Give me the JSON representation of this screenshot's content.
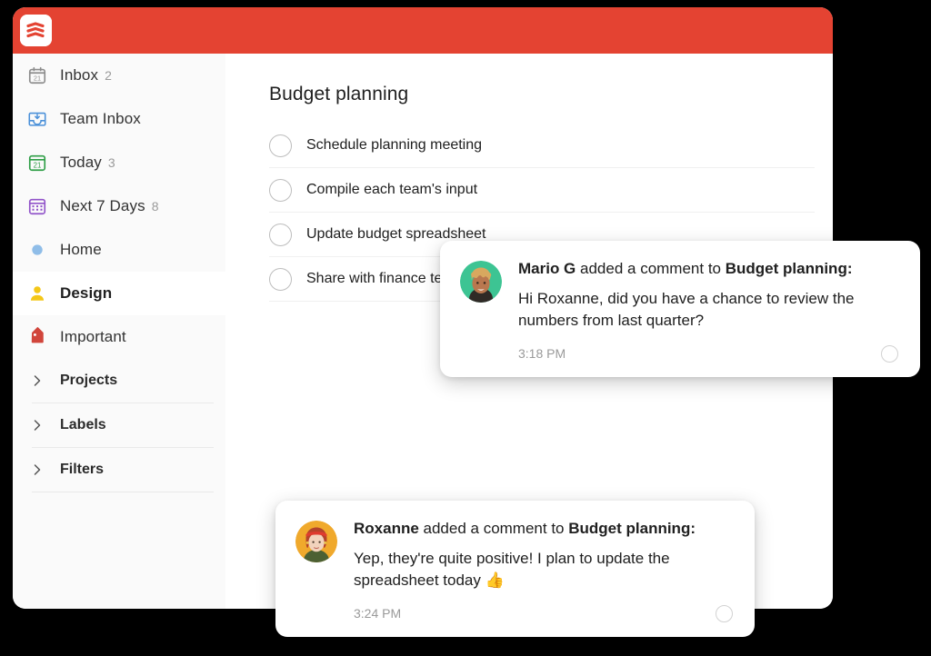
{
  "window": {
    "titlebar_color": "#e44332",
    "logo_icon": "todoist-logo-icon"
  },
  "sidebar": {
    "items": [
      {
        "label": "Inbox",
        "count": "2",
        "icon": "calendar-21-gray-icon",
        "selected": false
      },
      {
        "label": "Team Inbox",
        "count": "",
        "icon": "inbox-tray-blue-icon",
        "selected": false
      },
      {
        "label": "Today",
        "count": "3",
        "icon": "calendar-21-green-icon",
        "selected": false
      },
      {
        "label": "Next 7 Days",
        "count": "8",
        "icon": "calendar-grid-purple-icon",
        "selected": false
      },
      {
        "label": "Home",
        "count": "",
        "icon": "dot-blue-icon",
        "selected": false
      },
      {
        "label": "Design",
        "count": "",
        "icon": "person-yellow-icon",
        "selected": true
      },
      {
        "label": "Important",
        "count": "",
        "icon": "tag-red-icon",
        "selected": false
      }
    ],
    "sections": [
      {
        "label": "Projects",
        "icon": "chevron-right-icon"
      },
      {
        "label": "Labels",
        "icon": "chevron-right-icon"
      },
      {
        "label": "Filters",
        "icon": "chevron-right-icon"
      }
    ]
  },
  "main": {
    "title": "Budget planning",
    "tasks": [
      {
        "text": "Schedule planning meeting",
        "checked": false
      },
      {
        "text": "Compile each team's input",
        "checked": false
      },
      {
        "text": "Update budget spreadsheet",
        "checked": false
      },
      {
        "text": "Share with finance team",
        "checked": false
      }
    ]
  },
  "notifications": [
    {
      "actor": "Mario G",
      "action": " added a comment to ",
      "target": "Budget planning:",
      "message": "Hi Roxanne, did you have a chance to review the numbers from last quarter?",
      "time": "3:18 PM",
      "avatar_icon": "avatar-mario-icon",
      "avatar_bg": "#3dc493",
      "emoji": ""
    },
    {
      "actor": "Roxanne",
      "action": " added a comment to ",
      "target": "Budget planning:",
      "message": "Yep, they're quite positive! I plan to update the spreadsheet today ",
      "time": "3:24 PM",
      "avatar_icon": "avatar-roxanne-icon",
      "avatar_bg": "#f0a92c",
      "emoji": "👍"
    }
  ],
  "colors": {
    "brand_red": "#e44332",
    "sidebar_bg": "#fafafa",
    "selected_bg": "#ffffff",
    "inbox_icon": "#808080",
    "team_inbox_icon": "#4a90d9",
    "today_icon": "#2e9e46",
    "next7_icon": "#9153c9",
    "home_icon": "#8fbde8",
    "design_icon": "#f4c718",
    "important_icon": "#d1453b"
  }
}
